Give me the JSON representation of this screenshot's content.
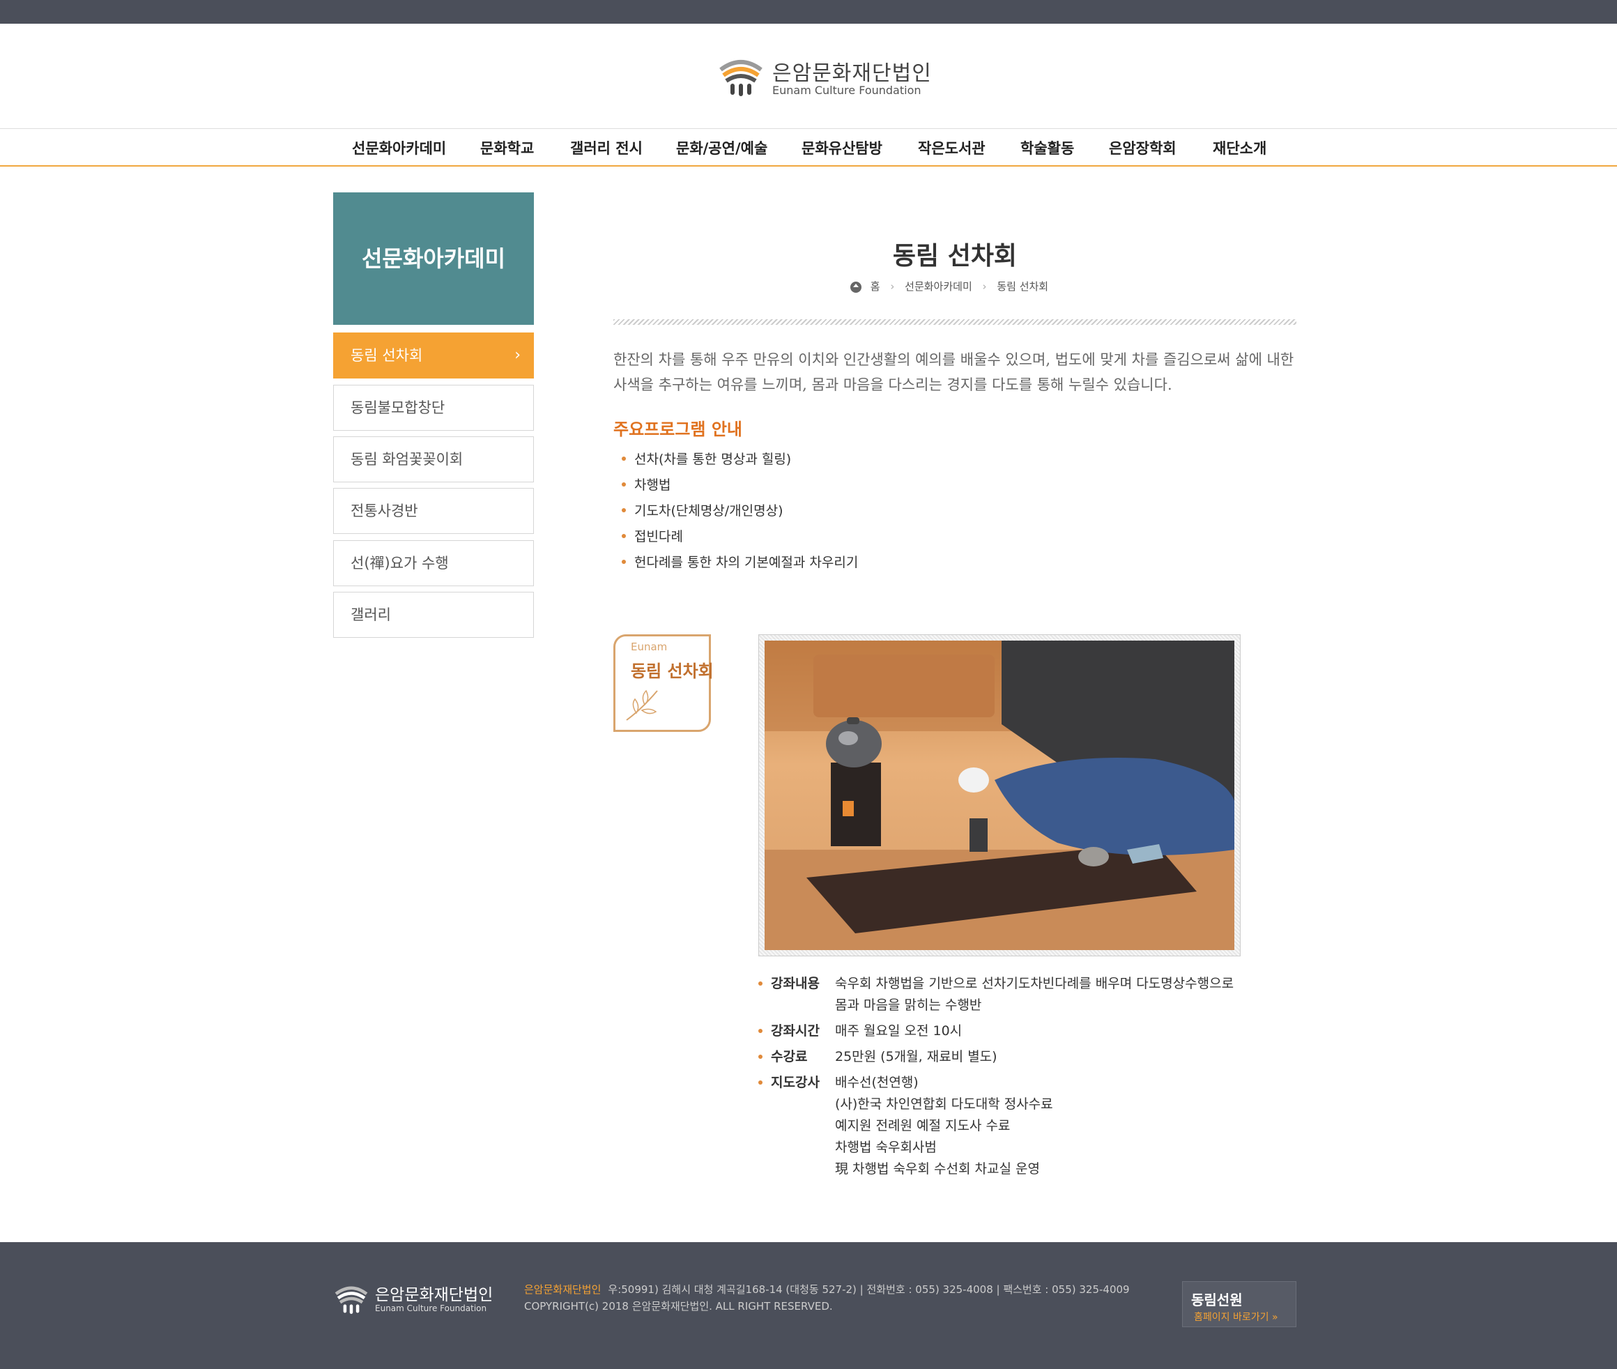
{
  "header": {
    "org_ko": "은암문화재단법인",
    "org_en": "Eunam Culture Foundation"
  },
  "nav": [
    {
      "label": "선문화아카데미"
    },
    {
      "label": "문화학교"
    },
    {
      "label": "갤러리 전시"
    },
    {
      "label": "문화/공연/예술"
    },
    {
      "label": "문화유산탐방"
    },
    {
      "label": "작은도서관"
    },
    {
      "label": "학술활동"
    },
    {
      "label": "은암장학회"
    },
    {
      "label": "재단소개"
    }
  ],
  "sidebar": {
    "title": "선문화아카데미",
    "items": [
      {
        "label": "동림 선차회",
        "active": true
      },
      {
        "label": "동림불모합창단"
      },
      {
        "label": "동림 화엄꽃꽂이회"
      },
      {
        "label": "전통사경반"
      },
      {
        "label": "선(禪)요가 수행"
      },
      {
        "label": "갤러리"
      }
    ]
  },
  "main": {
    "title": "동림 선차회",
    "breadcrumb": [
      "홈",
      "선문화아카데미",
      "동림 선차회"
    ],
    "intro": "한잔의 차를 통해 우주 만유의 이치와 인간생활의 예의를 배울수 있으며, 법도에 맞게 차를 즐김으로써 삶에 내한 사색을 추구하는 여유를 느끼며, 몸과 마음을 다스리는 경지를 다도를 통해 누릴수 있습니다.",
    "program_title": "주요프로그램 안내",
    "programs": [
      "선차(차를 통한 명상과 힐링)",
      "차행법",
      "기도차(단체명상/개인명상)",
      "접빈다례",
      "헌다례를 통한 차의 기본예절과 차우리기"
    ],
    "badge_en": "Eunam",
    "badge_ko": "동림 선차회",
    "info": [
      {
        "key": "강좌내용",
        "value": "숙우회 차행법을 기반으로 선차기도차빈다례를 배우며 다도명상수행으로\n몸과 마음을 맑히는 수행반"
      },
      {
        "key": "강좌시간",
        "value": "매주 월요일 오전 10시"
      },
      {
        "key": "수강료",
        "value": "25만원 (5개월, 재료비 별도)"
      },
      {
        "key": "지도강사",
        "value": "배수선(천연행)\n(사)한국 차인연합회 다도대학 정사수료\n예지원 전례원 예절 지도사 수료\n차행법 숙우회사범\n現 차행법 숙우회 수선회 차교실 운영"
      }
    ]
  },
  "footer": {
    "org_ko": "은암문화재단법인",
    "org_en": "Eunam Culture Foundation",
    "brand": "은암문화재단법인",
    "address": "우:50991) 김해시 대청 계곡길168-14 (대청동 527-2)   |   전화번호 : 055) 325-4008   |   팩스번호 : 055) 325-4009",
    "copyright": "COPYRIGHT(c) 2018 은암문화재단법인. ALL RIGHT RESERVED.",
    "site_name": "동림선원",
    "site_link": "홈페이지 바로가기 »"
  },
  "colors": {
    "accent": "#f5a233",
    "sidebar_head": "#518b90",
    "dark_bar": "#4b4f5a",
    "subtitle": "#e0721f"
  }
}
